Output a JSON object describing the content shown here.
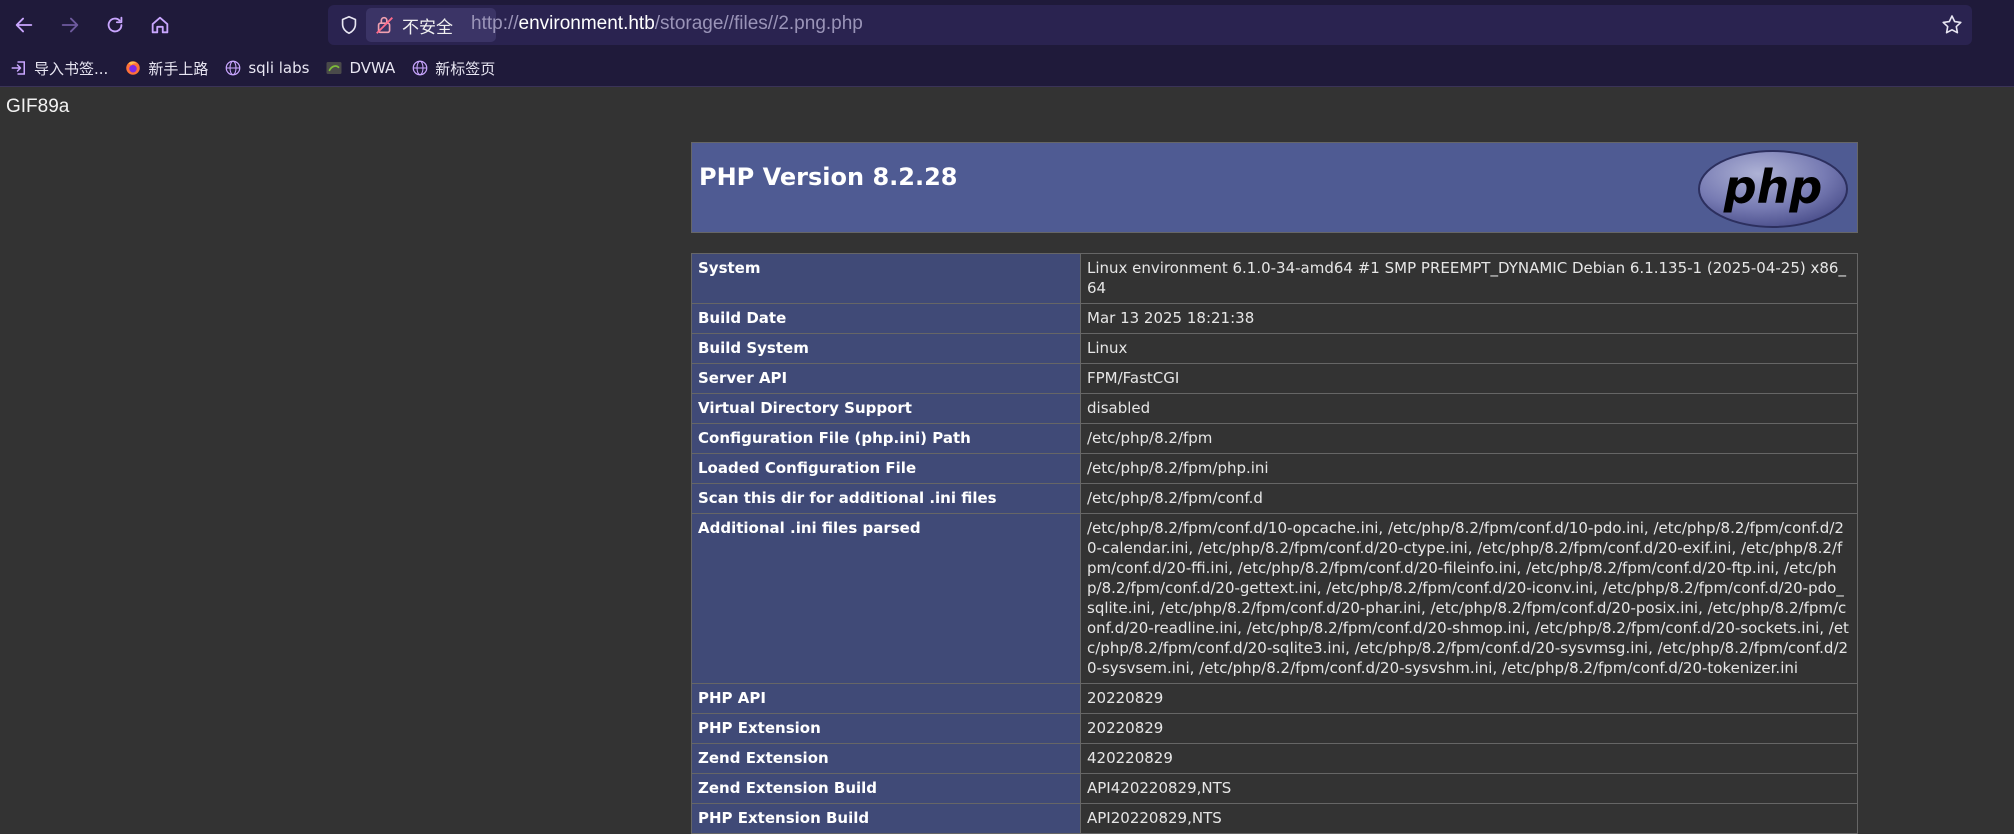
{
  "browser": {
    "security_label": "不安全",
    "url": {
      "scheme": "http://",
      "host": "environment.htb",
      "path": "/storage//files//2.png.php"
    },
    "bookmarks": [
      {
        "label": "导入书签...",
        "icon": "import-icon"
      },
      {
        "label": "新手上路",
        "icon": "firefox-icon"
      },
      {
        "label": "sqli labs",
        "icon": "globe-icon"
      },
      {
        "label": "DVWA",
        "icon": "dvwa-icon"
      },
      {
        "label": "新标签页",
        "icon": "globe-icon"
      }
    ],
    "accent_color": "#c9a6ff"
  },
  "page": {
    "gif_header": "GIF89a",
    "php_title": "PHP Version 8.2.28",
    "php_logo_text": "php",
    "rows": [
      {
        "key": "System",
        "value": "Linux environment 6.1.0-34-amd64 #1 SMP PREEMPT_DYNAMIC Debian 6.1.135-1 (2025-04-25) x86_64"
      },
      {
        "key": "Build Date",
        "value": "Mar 13 2025 18:21:38"
      },
      {
        "key": "Build System",
        "value": "Linux"
      },
      {
        "key": "Server API",
        "value": "FPM/FastCGI"
      },
      {
        "key": "Virtual Directory Support",
        "value": "disabled"
      },
      {
        "key": "Configuration File (php.ini) Path",
        "value": "/etc/php/8.2/fpm"
      },
      {
        "key": "Loaded Configuration File",
        "value": "/etc/php/8.2/fpm/php.ini"
      },
      {
        "key": "Scan this dir for additional .ini files",
        "value": "/etc/php/8.2/fpm/conf.d"
      },
      {
        "key": "Additional .ini files parsed",
        "value": "/etc/php/8.2/fpm/conf.d/10-opcache.ini, /etc/php/8.2/fpm/conf.d/10-pdo.ini, /etc/php/8.2/fpm/conf.d/20-calendar.ini, /etc/php/8.2/fpm/conf.d/20-ctype.ini, /etc/php/8.2/fpm/conf.d/20-exif.ini, /etc/php/8.2/fpm/conf.d/20-ffi.ini, /etc/php/8.2/fpm/conf.d/20-fileinfo.ini, /etc/php/8.2/fpm/conf.d/20-ftp.ini, /etc/php/8.2/fpm/conf.d/20-gettext.ini, /etc/php/8.2/fpm/conf.d/20-iconv.ini, /etc/php/8.2/fpm/conf.d/20-pdo_sqlite.ini, /etc/php/8.2/fpm/conf.d/20-phar.ini, /etc/php/8.2/fpm/conf.d/20-posix.ini, /etc/php/8.2/fpm/conf.d/20-readline.ini, /etc/php/8.2/fpm/conf.d/20-shmop.ini, /etc/php/8.2/fpm/conf.d/20-sockets.ini, /etc/php/8.2/fpm/conf.d/20-sqlite3.ini, /etc/php/8.2/fpm/conf.d/20-sysvmsg.ini, /etc/php/8.2/fpm/conf.d/20-sysvsem.ini, /etc/php/8.2/fpm/conf.d/20-sysvshm.ini, /etc/php/8.2/fpm/conf.d/20-tokenizer.ini"
      },
      {
        "key": "PHP API",
        "value": "20220829"
      },
      {
        "key": "PHP Extension",
        "value": "20220829"
      },
      {
        "key": "Zend Extension",
        "value": "420220829"
      },
      {
        "key": "Zend Extension Build",
        "value": "API420220829,NTS"
      },
      {
        "key": "PHP Extension Build",
        "value": "API20220829,NTS"
      }
    ]
  }
}
